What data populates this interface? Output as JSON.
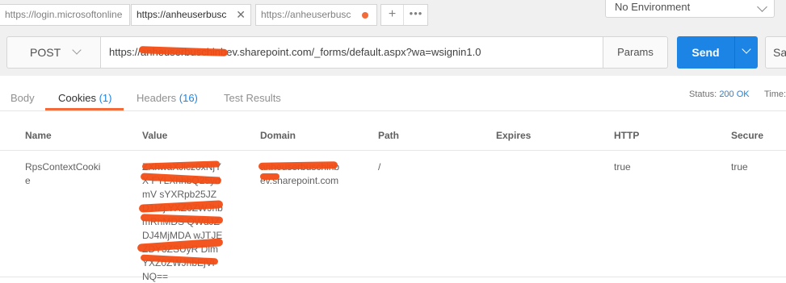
{
  "tabs": [
    {
      "label": "https://login.microsoftonline"
    },
    {
      "label": "https://anheuserbusc",
      "close": "✕"
    },
    {
      "label": "https://anheuserbusc"
    }
  ],
  "tab_buttons": {
    "add": "+",
    "more": "•••"
  },
  "environment": {
    "selected": "No Environment"
  },
  "request": {
    "method": "POST",
    "url": "https://anheuserbuschinbev.sharepoint.com/_forms/default.aspx?wa=wsignin1.0",
    "params_label": "Params",
    "send_label": "Send",
    "save_label": "Sa"
  },
  "response_tabs": [
    {
      "label": "Body",
      "count": ""
    },
    {
      "label": "Cookies",
      "count": "(1)"
    },
    {
      "label": "Headers",
      "count": "(16)"
    },
    {
      "label": "Test Results",
      "count": ""
    }
  ],
  "status": {
    "label": "Status:",
    "value": "200 OK",
    "time_label": "Time:"
  },
  "cookies": {
    "columns": [
      "Name",
      "Value",
      "Domain",
      "Path",
      "Expires",
      "HTTP",
      "Secure"
    ],
    "rows": [
      {
        "name": "RpsContextCookie",
        "value": "ZXhwaXJlcz0xNjYX FYLXhhbQ25ydmV sYXRpb25JZD1IZj YXZ0ZWJhbmRhMDS QWdJZDJ4MjMDA wJTJEZDY3ZSUyR DlmYXZ0ZWJhbEjVl NQ==",
        "domain": "anheuserbuschinbev.sharepoint.com",
        "path": "/",
        "expires": "",
        "http": "true",
        "secure": "true"
      }
    ]
  },
  "colors": {
    "accent_blue": "#1c84e4",
    "accent_orange": "#f26b3a",
    "redaction": "#f24d14"
  }
}
